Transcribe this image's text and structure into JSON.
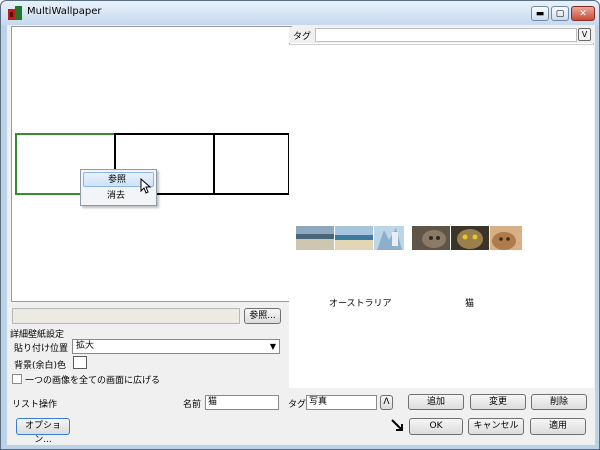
{
  "window": {
    "title": "MultiWallpaper"
  },
  "titlebar_buttons": {
    "minimize": "▬",
    "maximize": "▢",
    "close": "✕"
  },
  "left_panel": {
    "context_menu": [
      {
        "label": "参照",
        "hover": true
      },
      {
        "label": "消去",
        "hover": false
      }
    ],
    "path_value": "",
    "browse_button": "参照...",
    "detail_settings_label": "詳細壁紙設定",
    "paste_position_label": "貼り付け位置",
    "paste_position_value": "拡大",
    "bg_color_label": "背景(余白)色",
    "bg_color": "#ffffff",
    "span_checkbox_label": "一つの画像を全ての画面に広げる",
    "span_checked": false
  },
  "right_panel": {
    "tag_label": "タグ",
    "tag_value": "",
    "tag_dropdown_symbol": "V",
    "groups": [
      {
        "label": "オーストラリア",
        "thumbnails": [
          "beach-1",
          "beach-2",
          "beach-3"
        ]
      },
      {
        "label": "猫",
        "thumbnails": [
          "cat-1",
          "cat-2",
          "cat-3"
        ]
      }
    ]
  },
  "list_ops": {
    "label": "リスト操作",
    "name_label": "名前",
    "name_value": "猫",
    "tag_label": "タグ",
    "tag_value": "写真",
    "tag_toggle_symbol": "Λ",
    "add_button": "追加",
    "change_button": "変更",
    "delete_button": "削除"
  },
  "bottom": {
    "options_button": "オプション...",
    "ok_button": "OK",
    "cancel_button": "キャンセル",
    "apply_button": "適用"
  }
}
